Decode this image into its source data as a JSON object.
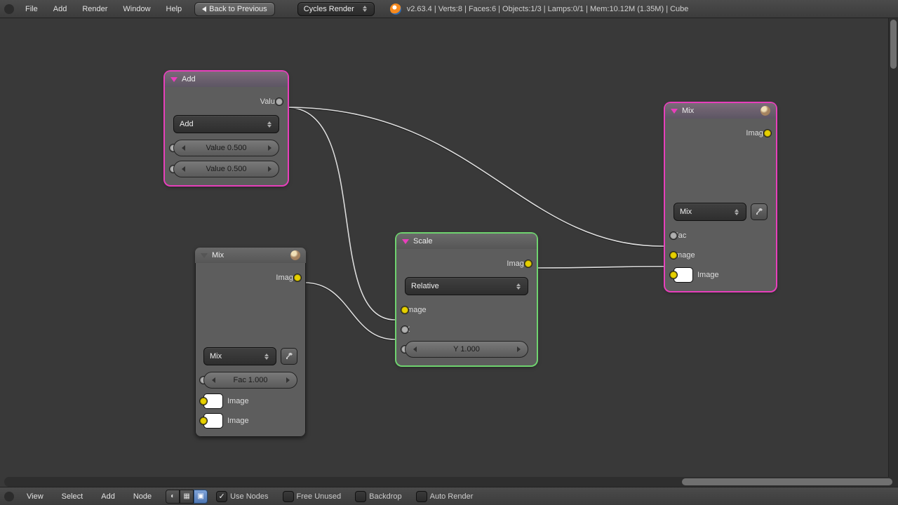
{
  "topmenu": {
    "file": "File",
    "add": "Add",
    "render": "Render",
    "window": "Window",
    "help": "Help"
  },
  "back_label": "Back to Previous",
  "engine_label": "Cycles Render",
  "status_line": "v2.63.4 | Verts:8 | Faces:6 | Objects:1/3 | Lamps:0/1 | Mem:10.12M (1.35M) | Cube",
  "footer": {
    "view": "View",
    "select": "Select",
    "add": "Add",
    "node": "Node",
    "use_nodes": "Use Nodes",
    "free_unused": "Free Unused",
    "backdrop": "Backdrop",
    "auto_render": "Auto Render"
  },
  "nodes": {
    "add": {
      "title": "Add",
      "out": "Value",
      "mode": "Add",
      "v1": "Value 0.500",
      "v2": "Value 0.500"
    },
    "mix1": {
      "title": "Mix",
      "out": "Image",
      "mode": "Mix",
      "fac": "Fac 1.000",
      "img1": "Image",
      "img2": "Image"
    },
    "scale": {
      "title": "Scale",
      "out": "Image",
      "mode": "Relative",
      "in_img": "Image",
      "x": "X",
      "y": "Y 1.000"
    },
    "mix2": {
      "title": "Mix",
      "out": "Image",
      "mode": "Mix",
      "fac": "Fac",
      "img1": "Image",
      "img2": "Image"
    }
  }
}
